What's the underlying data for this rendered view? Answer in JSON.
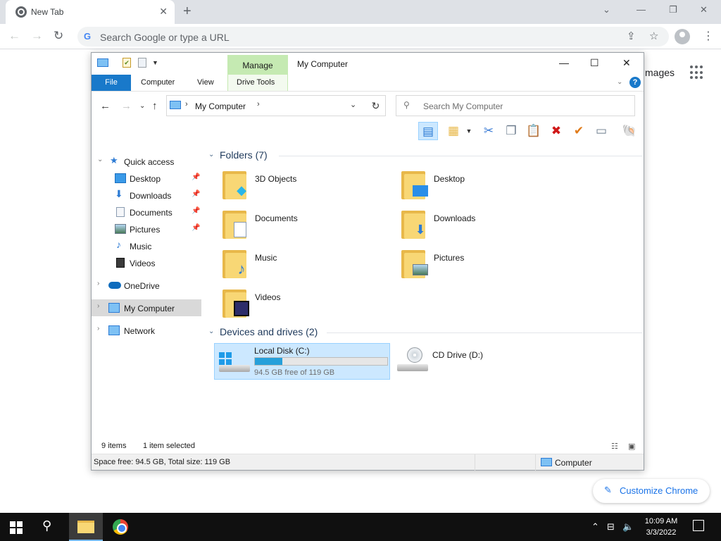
{
  "chrome": {
    "tab_title": "New Tab",
    "omnibox_placeholder": "Search Google or type a URL",
    "images_link": "mages",
    "customize_label": "Customize Chrome"
  },
  "explorer": {
    "title": "My Computer",
    "context_tab_header": "Manage",
    "ribbon_tabs": {
      "file": "File",
      "computer": "Computer",
      "view": "View",
      "drive_tools": "Drive Tools"
    },
    "address_path": "My Computer",
    "search_placeholder": "Search My Computer",
    "sidebar": {
      "quick_access": "Quick access",
      "pinned": [
        {
          "label": "Desktop",
          "icon": "desktop-icon"
        },
        {
          "label": "Downloads",
          "icon": "downloads-icon"
        },
        {
          "label": "Documents",
          "icon": "documents-icon"
        },
        {
          "label": "Pictures",
          "icon": "pictures-icon"
        }
      ],
      "unpinned": [
        {
          "label": "Music",
          "icon": "music-icon"
        },
        {
          "label": "Videos",
          "icon": "videos-icon"
        }
      ],
      "onedrive": "OneDrive",
      "my_computer": "My Computer",
      "network": "Network"
    },
    "folders_header": "Folders (7)",
    "folders": [
      {
        "label": "3D Objects",
        "icon": "3d-objects-icon"
      },
      {
        "label": "Desktop",
        "icon": "desktop-icon"
      },
      {
        "label": "Documents",
        "icon": "documents-icon"
      },
      {
        "label": "Downloads",
        "icon": "downloads-icon"
      },
      {
        "label": "Music",
        "icon": "music-icon"
      },
      {
        "label": "Pictures",
        "icon": "pictures-icon"
      },
      {
        "label": "Videos",
        "icon": "videos-icon"
      }
    ],
    "devices_header": "Devices and drives (2)",
    "drives": [
      {
        "label": "Local Disk (C:)",
        "free": "94.5 GB free of 119 GB",
        "used_fraction": 0.21
      },
      {
        "label": "CD Drive (D:)"
      }
    ],
    "status": {
      "items": "9 items",
      "selected": "1 item selected"
    },
    "details": {
      "space": "Space free: 94.5 GB, Total size: 119 GB",
      "computer": "Computer"
    }
  },
  "taskbar": {
    "time": "10:09 AM",
    "date": "3/3/2022"
  },
  "colors": {
    "accent": "#1979ca",
    "selection": "#cce8ff",
    "drive_bar": "#26a0da",
    "context_tab": "#c5eab2"
  }
}
